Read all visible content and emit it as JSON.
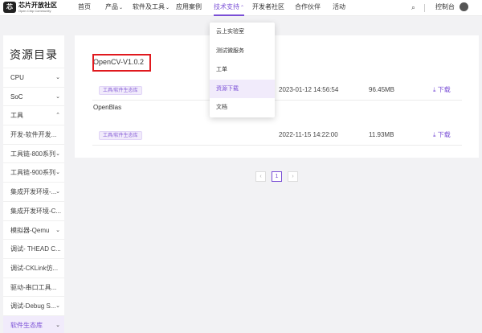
{
  "logo": {
    "mark": "芯",
    "name": "芯片开放社区",
    "tagline": "Open Chip Community"
  },
  "nav": {
    "items": [
      {
        "label": "首页"
      },
      {
        "label": "产品",
        "caret": "⌄"
      },
      {
        "label": "软件及工具",
        "caret": "⌄"
      },
      {
        "label": "应用案例"
      },
      {
        "label": "技术支持",
        "caret": "⌃"
      },
      {
        "label": "开发者社区"
      },
      {
        "label": "合作伙伴"
      },
      {
        "label": "活动"
      }
    ],
    "search_icon": "⌕",
    "console": "控制台"
  },
  "sidebar": {
    "title": "资源目录",
    "items": [
      {
        "label": "CPU",
        "chev": "⌄"
      },
      {
        "label": "SoC",
        "chev": "⌄"
      },
      {
        "label": "工具",
        "chev": "⌃"
      },
      {
        "label": "开发-软件开发..."
      },
      {
        "label": "工具链-800系列",
        "chev": "⌄"
      },
      {
        "label": "工具链-900系列",
        "chev": "⌄"
      },
      {
        "label": "集成开发环境-...",
        "chev": "⌄"
      },
      {
        "label": "集成开发环境-C..."
      },
      {
        "label": "模拟器-Qemu",
        "chev": "⌄"
      },
      {
        "label": "调试- THEAD C..."
      },
      {
        "label": "调试-CKLink仿..."
      },
      {
        "label": "驱动-串口工具..."
      },
      {
        "label": "调试-Debug S...",
        "chev": "⌄"
      },
      {
        "label": "软件生态库",
        "chev": "⌄"
      }
    ]
  },
  "main": {
    "title": "OpenCV-V1.0.2",
    "rows": [
      {
        "tag": "工具/软件生态库",
        "date": "2023-01-12 14:56:54",
        "size": "96.45MB",
        "download": "下载"
      },
      {
        "name": "OpenBlas",
        "tag": "工具/软件生态库",
        "date": "2022-11-15 14:22:00",
        "size": "11.93MB",
        "download": "下载"
      }
    ]
  },
  "pagination": {
    "prev": "‹",
    "current": "1",
    "next": "›"
  },
  "dropdown": {
    "items": [
      {
        "label": "云上实验室"
      },
      {
        "label": "测试微服务"
      },
      {
        "label": "工单"
      },
      {
        "label": "资源下载"
      },
      {
        "label": "文档"
      }
    ]
  },
  "colors": {
    "accent": "#7a4fd6",
    "highlight_border": "#e0191e",
    "tag_bg": "#f1ebfb"
  }
}
